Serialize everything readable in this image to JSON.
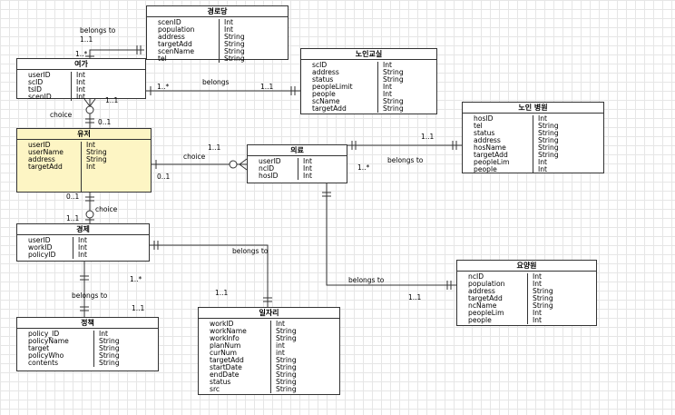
{
  "colors": {
    "canvas": "#ffffff",
    "grid": "#e6e6e6",
    "entity_fill": "#ffffff",
    "selected_fill": "#fdf5c4",
    "line": "#333333"
  },
  "entities": {
    "gyeongrodang": {
      "title": "경로당",
      "attributes": [
        "scenID",
        "population",
        "address",
        "targetAdd",
        "scenName",
        "tel"
      ],
      "types": [
        "Int",
        "Int",
        "String",
        "String",
        "String",
        "String"
      ]
    },
    "yeoga": {
      "title": "여가",
      "attributes": [
        "userID",
        "scID",
        "tsID",
        "scenID"
      ],
      "types": [
        "Int",
        "Int",
        "Int",
        "Int"
      ]
    },
    "noingyosil": {
      "title": "노인교실",
      "attributes": [
        "scID",
        "address",
        "status",
        "peopleLimit",
        "people",
        "scName",
        "targetAdd"
      ],
      "types": [
        "Int",
        "String",
        "String",
        "Int",
        "Int",
        "String",
        "String"
      ]
    },
    "noinbyeongwon": {
      "title": "노인 병원",
      "attributes": [
        "hosID",
        "tel",
        "status",
        "address",
        "hosName",
        "targetAdd",
        "peopleLim",
        "people"
      ],
      "types": [
        "Int",
        "String",
        "String",
        "String",
        "String",
        "String",
        "Int",
        "Int"
      ]
    },
    "yujeo": {
      "title": "유저",
      "attributes": [
        "userID",
        "userName",
        "address",
        "targetAdd"
      ],
      "types": [
        "Int",
        "String",
        "String",
        "Int"
      ]
    },
    "uiryo": {
      "title": "의료",
      "attributes": [
        "userID",
        "ncID",
        "hosID"
      ],
      "types": [
        "Int",
        "Int",
        "Int"
      ]
    },
    "gyeongje": {
      "title": "경제",
      "attributes": [
        "userID",
        "workID",
        "policyID"
      ],
      "types": [
        "Int",
        "Int",
        "Int"
      ]
    },
    "yoyangwon": {
      "title": "요양원",
      "attributes": [
        "ncID",
        "population",
        "address",
        "targetAdd",
        "ncName",
        "peopleLim",
        "people"
      ],
      "types": [
        "Int",
        "Int",
        "String",
        "String",
        "String",
        "Int",
        "Int"
      ]
    },
    "jeongchaek": {
      "title": "정책",
      "attributes": [
        "policy_ID",
        "policyName",
        "target",
        "policyWho",
        "contents"
      ],
      "types": [
        "Int",
        "String",
        "String",
        "String",
        "String"
      ]
    },
    "iljari": {
      "title": "일자리",
      "attributes": [
        "workID",
        "workName",
        "workInfo",
        "planNum",
        "curNum",
        "targetAdd",
        "startDate",
        "endDate",
        "status",
        "src"
      ],
      "types": [
        "Int",
        "String",
        "String",
        "int",
        "int",
        "String",
        "String",
        "String",
        "String",
        "String"
      ]
    }
  },
  "labels": {
    "belongs_to_1": "belongs to",
    "card_1_1_a": "1..1",
    "card_1_many_a": "1..*",
    "belongs_2": "belongs",
    "card_1_many_b": "1..*",
    "card_1_1_b": "1..1",
    "card_1_1_c": "1..1",
    "choice_1": "choice",
    "card_0_1_a": "0..1",
    "card_1_1_d": "1..1",
    "choice_2": "choice",
    "card_0_1_b": "0..1",
    "card_1_1_e": "1..1",
    "card_1_many_c": "1..*",
    "belongs_to_3": "belongs to",
    "card_0_1_c": "0..1",
    "card_1_1_f": "1..1",
    "choice_3": "choice",
    "belongs_to_4": "belongs to",
    "card_1_many_d": "1..*",
    "card_1_1_g": "1..1",
    "belongs_to_5": "belongs to",
    "card_1_1_h": "1..1",
    "belongs_to_6": "belongs to",
    "card_1_1_i": "1..1"
  }
}
